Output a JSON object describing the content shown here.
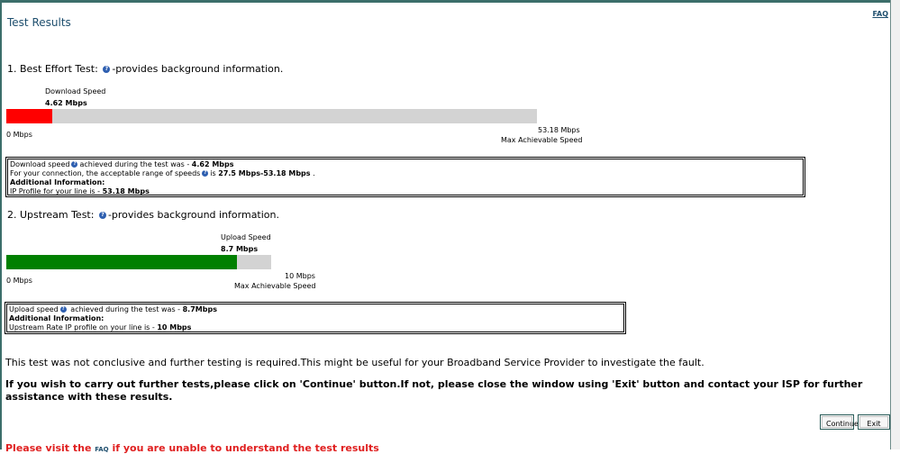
{
  "header": {
    "title": "Test Results",
    "faq_label": "FAQ"
  },
  "best_effort": {
    "heading": "1. Best Effort Test:",
    "heading_suffix": "-provides background information.",
    "speed_label": "Download Speed",
    "speed_value": "4.62 Mbps",
    "min_label": "0 Mbps",
    "max_value": "53.18 Mbps",
    "max_label": "Max Achievable Speed",
    "fill_fraction": 0.087,
    "fill_color": "#ff0000",
    "info": {
      "line1_prefix": "Download speed",
      "line1_mid": "achieved during the test was - ",
      "line1_value": "4.62 Mbps",
      "line2_prefix": "For your connection, the acceptable range of speeds",
      "line2_mid": "is ",
      "line2_value": "27.5 Mbps-53.18 Mbps",
      "line2_suffix": " .",
      "line3": "Additional Information:",
      "line4_prefix": "IP Profile for your line is - ",
      "line4_value": "53.18 Mbps"
    }
  },
  "upstream": {
    "heading": "2. Upstream Test:",
    "heading_suffix": "-provides background information.",
    "speed_label": "Upload Speed",
    "speed_value": "8.7 Mbps",
    "min_label": "0 Mbps",
    "max_value": "10 Mbps",
    "max_label": "Max Achievable Speed",
    "fill_fraction": 0.87,
    "fill_color": "#008000",
    "info": {
      "line1_prefix": "Upload speed",
      "line1_mid": " achieved during the test was - ",
      "line1_value": "8.7Mbps",
      "line2": "Additional Information:",
      "line3_prefix": "Upstream Rate IP profile on your line is - ",
      "line3_value": "10 Mbps"
    }
  },
  "messages": {
    "inconclusive": "This test was not conclusive and further testing is required.This might be useful for your Broadband Service Provider to investigate the fault.",
    "instructions": "If you wish to carry out further tests,please click on 'Continue' button.If not, please close the window using 'Exit' button and contact your ISP for further assistance with these results."
  },
  "buttons": {
    "continue_label": "Continue",
    "exit_label": "Exit"
  },
  "footer": {
    "prefix": "Please visit the ",
    "faq_label": "FAQ",
    "suffix": " if you are unable to understand the test results"
  },
  "icons": {
    "help": "question-circle-icon"
  },
  "colors": {
    "accent": "#1f4f6e",
    "frame": "#3c6e6a",
    "footer_text": "#e02020"
  }
}
